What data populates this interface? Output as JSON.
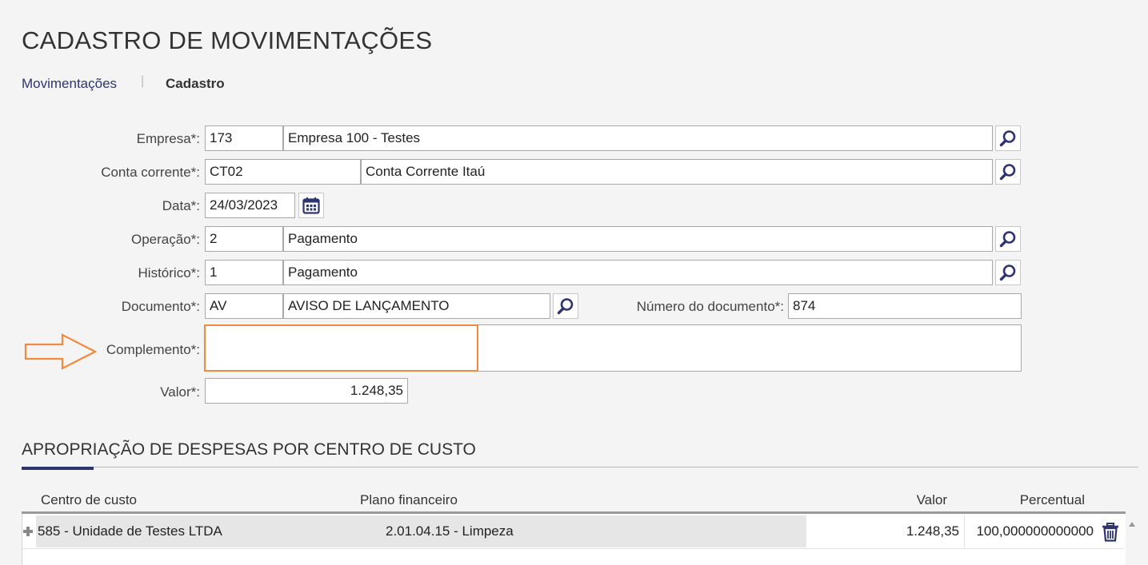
{
  "page": {
    "title": "CADASTRO DE MOVIMENTAÇÕES"
  },
  "breadcrumb": {
    "link": "Movimentações",
    "separator": "|",
    "current": "Cadastro"
  },
  "form": {
    "empresa": {
      "label": "Empresa*:",
      "code": "173",
      "name": "Empresa 100 - Testes"
    },
    "conta_corrente": {
      "label": "Conta corrente*:",
      "code": "CT02",
      "name": "Conta Corrente Itaú"
    },
    "data": {
      "label": "Data*:",
      "value": "24/03/2023"
    },
    "operacao": {
      "label": "Operação*:",
      "code": "2",
      "name": "Pagamento"
    },
    "historico": {
      "label": "Histórico*:",
      "code": "1",
      "name": "Pagamento"
    },
    "documento": {
      "label": "Documento*:",
      "code": "AV",
      "name": "AVISO DE LANÇAMENTO"
    },
    "numero_documento": {
      "label": "Número do documento*:",
      "value": "874"
    },
    "complemento": {
      "label": "Complemento*:",
      "value": ""
    },
    "valor": {
      "label": "Valor*:",
      "value": "1.248,35"
    }
  },
  "section": {
    "title": "APROPRIAÇÃO DE DESPESAS POR CENTRO DE CUSTO"
  },
  "grid": {
    "columns": [
      "Centro de custo",
      "Plano financeiro",
      "Valor",
      "Percentual"
    ],
    "rows": [
      {
        "centro_custo": "585 - Unidade de Testes LTDA",
        "plano_financeiro": "2.01.04.15 - Limpeza",
        "valor": "1.248,35",
        "percentual": "100,000000000000"
      }
    ]
  },
  "colors": {
    "accent": "#2e3470",
    "highlight": "#f08a3c"
  },
  "icons": {
    "search": "search-icon",
    "calendar": "calendar-icon",
    "delete": "trash-icon",
    "expand": "plus-icon",
    "arrow": "arrow-right-icon"
  }
}
